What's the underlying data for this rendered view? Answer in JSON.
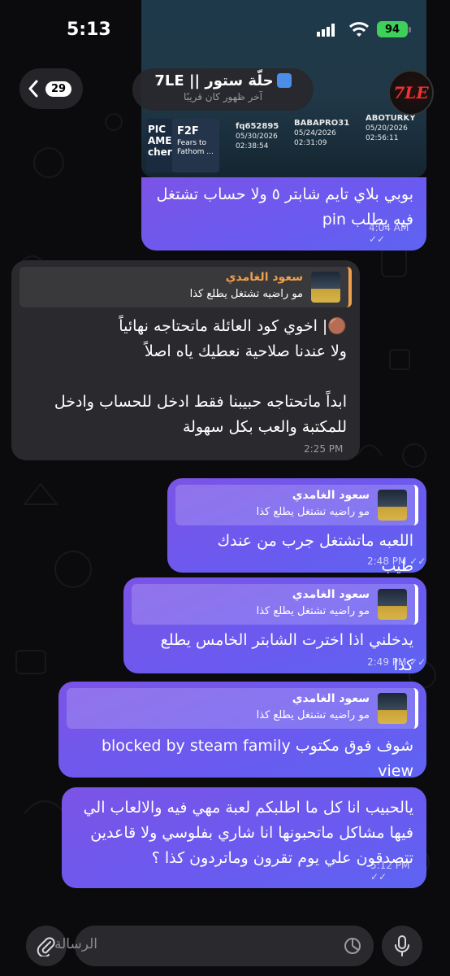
{
  "status_bar": {
    "time": "5:13",
    "battery": "94"
  },
  "header": {
    "back_count": "29",
    "chat_name": "حلّة ستور || 7LE",
    "chat_status": "آخر ظهور كان قريبًا",
    "avatar_text": "7LE"
  },
  "image_preview": {
    "tile1": "PIC AMES cher",
    "tile2_title": "F2F",
    "tile2_sub": "Fears to Fathom ...",
    "accounts": [
      {
        "user": "fq652895",
        "date": "05/30/2026",
        "time": "02:38:54"
      },
      {
        "user": "BABAPRO31",
        "date": "05/24/2026",
        "time": "02:31:09"
      },
      {
        "user": "ABOTURKY",
        "date": "05/20/2026",
        "time": "02:56:11"
      }
    ]
  },
  "messages": [
    {
      "id": "m1",
      "dir": "out",
      "text_lines": [
        "بوبي بلاي تايم شابتر ٥ ولا حساب تشتغل",
        "فيه يطلب pin"
      ],
      "time": "4:04 AM"
    },
    {
      "id": "m2",
      "dir": "in",
      "quote_name": "سعود الغامدي",
      "quote_text": "مو راضيه تشتغل يطلع كذا",
      "text_lines": [
        "🟤| اخوي كود العائلة ماتحتاجه نهائياً",
        "ولا عندنا صلاحية نعطيك ياه اصلاً",
        "",
        "ابداً ماتحتاجه حبيبنا فقط ادخل للحساب وادخل",
        "للمكتبة والعب بكل سهولة"
      ],
      "time": "2:25 PM"
    },
    {
      "id": "m3",
      "dir": "out",
      "quote_name": "سعود الغامدي",
      "quote_text": "مو راضيه تشتغل يطلع كذا",
      "text_lines": [
        "اللعبه ماتشتغل جرب من عندك طيب"
      ],
      "time": "2:48 PM"
    },
    {
      "id": "m4",
      "dir": "out",
      "quote_name": "سعود الغامدي",
      "quote_text": "مو راضيه تشتغل يطلع كذا",
      "text_lines": [
        "يدخلني اذا اخترت الشابتر الخامس يطلع كذا"
      ],
      "time": "2:49 PM"
    },
    {
      "id": "m5",
      "dir": "out",
      "quote_name": "سعود الغامدي",
      "quote_text": "مو راضيه تشتغل يطلع كذا",
      "text_lines": [
        "شوف فوق مكتوب blocked by steam family view"
      ],
      "time": "2:49 PM"
    },
    {
      "id": "m6",
      "dir": "out",
      "text_lines": [
        "يالحبيب انا كل ما اطلبكم لعبة مهي فيه والالعاب الي",
        "فيها مشاكل ماتحبونها انا شاري بفلوسي ولا قاعدين",
        "تتصدقون علي يوم تقرون وماتردون كذا ؟"
      ],
      "time": "5:12 PM"
    }
  ],
  "input": {
    "placeholder": "الرسالة"
  },
  "colors": {
    "outgoing": "#6f57ec",
    "incoming": "#2a2a2e",
    "quote_name_in": "#f0a04a"
  }
}
